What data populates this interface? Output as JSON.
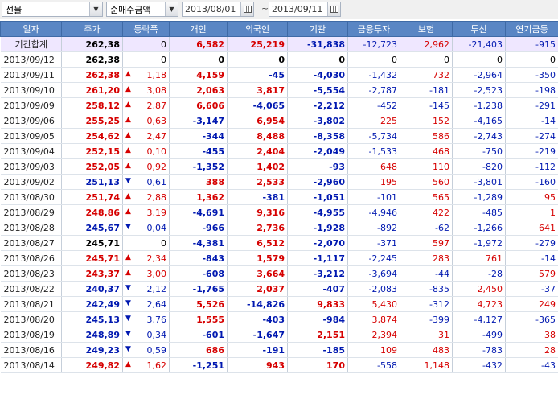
{
  "toolbar": {
    "market": "선물",
    "metric": "순매수금액",
    "date_from": "2013/08/01",
    "date_sep": "~",
    "date_to": "2013/09/11"
  },
  "colors": {
    "header_bg": "#5a86c4",
    "up": "#d60000",
    "down": "#0018b0",
    "summary_bg": "#efe7ff"
  },
  "table": {
    "headers": [
      "일자",
      "주가",
      "등락폭",
      "개인",
      "외국인",
      "기관",
      "금융투자",
      "보험",
      "투신",
      "연기금등"
    ],
    "summary": {
      "label": "기간합계",
      "price": "262,38",
      "change": "0",
      "indiv": "6,582",
      "foreign": "25,219",
      "inst": "-31,838",
      "fin": "-12,723",
      "ins": "2,962",
      "trust": "-21,403",
      "pension": "-915"
    },
    "rows": [
      {
        "date": "2013/09/12",
        "price": "262,38",
        "dir": "flat",
        "change": "0",
        "indiv": "0",
        "foreign": "0",
        "inst": "0",
        "fin": "0",
        "ins": "0",
        "trust": "0",
        "pension": "0"
      },
      {
        "date": "2013/09/11",
        "price": "262,38",
        "dir": "up",
        "change": "1,18",
        "indiv": "4,159",
        "foreign": "-45",
        "inst": "-4,030",
        "fin": "-1,432",
        "ins": "732",
        "trust": "-2,964",
        "pension": "-350"
      },
      {
        "date": "2013/09/10",
        "price": "261,20",
        "dir": "up",
        "change": "3,08",
        "indiv": "2,063",
        "foreign": "3,817",
        "inst": "-5,554",
        "fin": "-2,787",
        "ins": "-181",
        "trust": "-2,523",
        "pension": "-198"
      },
      {
        "date": "2013/09/09",
        "price": "258,12",
        "dir": "up",
        "change": "2,87",
        "indiv": "6,606",
        "foreign": "-4,065",
        "inst": "-2,212",
        "fin": "-452",
        "ins": "-145",
        "trust": "-1,238",
        "pension": "-291"
      },
      {
        "date": "2013/09/06",
        "price": "255,25",
        "dir": "up",
        "change": "0,63",
        "indiv": "-3,147",
        "foreign": "6,954",
        "inst": "-3,802",
        "fin": "225",
        "ins": "152",
        "trust": "-4,165",
        "pension": "-14"
      },
      {
        "date": "2013/09/05",
        "price": "254,62",
        "dir": "up",
        "change": "2,47",
        "indiv": "-344",
        "foreign": "8,488",
        "inst": "-8,358",
        "fin": "-5,734",
        "ins": "586",
        "trust": "-2,743",
        "pension": "-274"
      },
      {
        "date": "2013/09/04",
        "price": "252,15",
        "dir": "up",
        "change": "0,10",
        "indiv": "-455",
        "foreign": "2,404",
        "inst": "-2,049",
        "fin": "-1,533",
        "ins": "468",
        "trust": "-750",
        "pension": "-219"
      },
      {
        "date": "2013/09/03",
        "price": "252,05",
        "dir": "up",
        "change": "0,92",
        "indiv": "-1,352",
        "foreign": "1,402",
        "inst": "-93",
        "fin": "648",
        "ins": "110",
        "trust": "-820",
        "pension": "-112"
      },
      {
        "date": "2013/09/02",
        "price": "251,13",
        "dir": "down",
        "change": "0,61",
        "indiv": "388",
        "foreign": "2,533",
        "inst": "-2,960",
        "fin": "195",
        "ins": "560",
        "trust": "-3,801",
        "pension": "-160"
      },
      {
        "date": "2013/08/30",
        "price": "251,74",
        "dir": "up",
        "change": "2,88",
        "indiv": "1,362",
        "foreign": "-381",
        "inst": "-1,051",
        "fin": "-101",
        "ins": "565",
        "trust": "-1,289",
        "pension": "95"
      },
      {
        "date": "2013/08/29",
        "price": "248,86",
        "dir": "up",
        "change": "3,19",
        "indiv": "-4,691",
        "foreign": "9,316",
        "inst": "-4,955",
        "fin": "-4,946",
        "ins": "422",
        "trust": "-485",
        "pension": "1"
      },
      {
        "date": "2013/08/28",
        "price": "245,67",
        "dir": "down",
        "change": "0,04",
        "indiv": "-966",
        "foreign": "2,736",
        "inst": "-1,928",
        "fin": "-892",
        "ins": "-62",
        "trust": "-1,266",
        "pension": "641"
      },
      {
        "date": "2013/08/27",
        "price": "245,71",
        "dir": "flat",
        "change": "0",
        "indiv": "-4,381",
        "foreign": "6,512",
        "inst": "-2,070",
        "fin": "-371",
        "ins": "597",
        "trust": "-1,972",
        "pension": "-279"
      },
      {
        "date": "2013/08/26",
        "price": "245,71",
        "dir": "up",
        "change": "2,34",
        "indiv": "-843",
        "foreign": "1,579",
        "inst": "-1,117",
        "fin": "-2,245",
        "ins": "283",
        "trust": "761",
        "pension": "-14"
      },
      {
        "date": "2013/08/23",
        "price": "243,37",
        "dir": "up",
        "change": "3,00",
        "indiv": "-608",
        "foreign": "3,664",
        "inst": "-3,212",
        "fin": "-3,694",
        "ins": "-44",
        "trust": "-28",
        "pension": "579"
      },
      {
        "date": "2013/08/22",
        "price": "240,37",
        "dir": "down",
        "change": "2,12",
        "indiv": "-1,765",
        "foreign": "2,037",
        "inst": "-407",
        "fin": "-2,083",
        "ins": "-835",
        "trust": "2,450",
        "pension": "-37"
      },
      {
        "date": "2013/08/21",
        "price": "242,49",
        "dir": "down",
        "change": "2,64",
        "indiv": "5,526",
        "foreign": "-14,826",
        "inst": "9,833",
        "fin": "5,430",
        "ins": "-312",
        "trust": "4,723",
        "pension": "249"
      },
      {
        "date": "2013/08/20",
        "price": "245,13",
        "dir": "down",
        "change": "3,76",
        "indiv": "1,555",
        "foreign": "-403",
        "inst": "-984",
        "fin": "3,874",
        "ins": "-399",
        "trust": "-4,127",
        "pension": "-365"
      },
      {
        "date": "2013/08/19",
        "price": "248,89",
        "dir": "down",
        "change": "0,34",
        "indiv": "-601",
        "foreign": "-1,647",
        "inst": "2,151",
        "fin": "2,394",
        "ins": "31",
        "trust": "-499",
        "pension": "38"
      },
      {
        "date": "2013/08/16",
        "price": "249,23",
        "dir": "down",
        "change": "0,59",
        "indiv": "686",
        "foreign": "-191",
        "inst": "-185",
        "fin": "109",
        "ins": "483",
        "trust": "-783",
        "pension": "28"
      },
      {
        "date": "2013/08/14",
        "price": "249,82",
        "dir": "up",
        "change": "1,62",
        "indiv": "-1,251",
        "foreign": "943",
        "inst": "170",
        "fin": "-558",
        "ins": "1,148",
        "trust": "-432",
        "pension": "-43"
      }
    ]
  }
}
